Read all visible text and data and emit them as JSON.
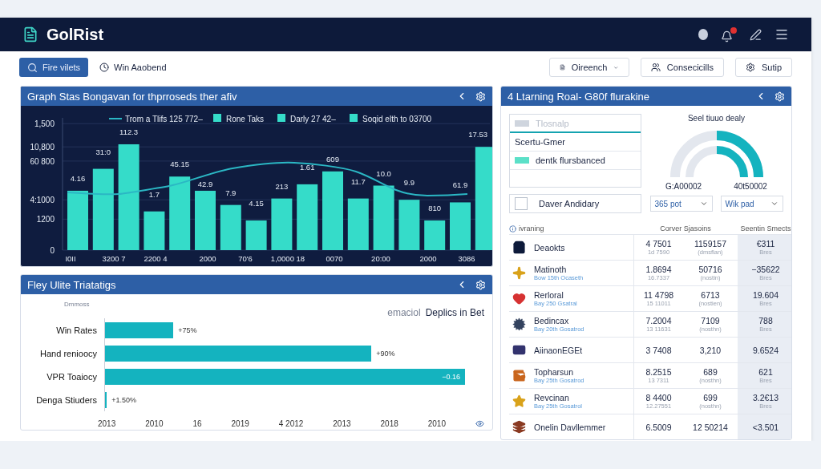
{
  "app": {
    "title": "GolRist"
  },
  "toolbar": {
    "primary_button": "Fire vilets",
    "time_label": "Win Aaobend",
    "dropdown": "Oireench",
    "buttons": [
      "Consecicills",
      "Sutip"
    ]
  },
  "top_chart": {
    "title": "Graph Stas Bongavan for thprroseds ther afiv",
    "legend": [
      {
        "kind": "line",
        "label": "Trom a Tlifs 125 772–"
      },
      {
        "kind": "swatch",
        "label": "Rone Taks"
      },
      {
        "kind": "swatch",
        "label": "Darly 27 42–"
      },
      {
        "kind": "swatch",
        "label": "Soqid elth to 03700"
      }
    ],
    "y_labels": [
      "1,500",
      "10,800",
      "60 800",
      "4:1000",
      "1200",
      "0"
    ],
    "x_labels": [
      "I0II",
      "3200 7",
      "2200 4",
      "2000",
      "70'6",
      "1,0000 18",
      "0070",
      "20:00",
      "2000",
      "3086"
    ],
    "bar_labels": [
      "4.16",
      "31:0",
      "112.3",
      "1.7",
      "45.15",
      "42.9",
      "7.9",
      "4.15",
      "213",
      "1.61",
      "609",
      "11.7",
      "10.0",
      "9.9",
      "810",
      "61.9",
      "17.53"
    ]
  },
  "bottom_chart": {
    "title": "Fley Ulite Triatatigs",
    "legend": "Dmmoss",
    "note": "emaciol",
    "heading": "Deplics in Bet",
    "rows": [
      {
        "label": "Win Rates",
        "level": 0.19,
        "reading": "+75%"
      },
      {
        "label": "Hand renioocy",
        "level": 0.74,
        "reading": "+90%"
      },
      {
        "label": "VPR Toaiocy",
        "level": 1.0,
        "reading": "−0.16"
      },
      {
        "label": "Denga Stiuders",
        "level": 0.005,
        "reading": "+1.50%"
      }
    ],
    "x_labels": [
      "2013",
      "2010",
      "16",
      "2019",
      "4 2012",
      "2013",
      "2018",
      "2010"
    ]
  },
  "right_panel": {
    "title": "4 Ltarning Roal- G80f flurakine",
    "list": [
      {
        "label": "Tlosnalp",
        "selected": true,
        "disabled": true
      },
      {
        "label": "Scertu-Gmer",
        "selected": false,
        "disabled": false
      },
      {
        "label": "dentk flursbanced",
        "selected": false,
        "disabled": false
      }
    ],
    "checkbox": {
      "label": "Daver Andidary",
      "checked": false
    },
    "gauge": {
      "title": "Seel tiuuo dealy"
    },
    "values": [
      "G:A00002",
      "40t50002"
    ],
    "dropdowns": [
      "365 pot",
      "Wik pad"
    ],
    "table": {
      "columns": [
        "ivraning",
        "Corver Sjasoins",
        "Seentin Smects"
      ],
      "rows": [
        {
          "name": "Deaokts",
          "a": "4 7501",
          "a_sub": "1d 7590",
          "b": "1159157",
          "b_sub": "(dmsflan)",
          "c": "€311",
          "c_sub": "Bres"
        },
        {
          "name": "Matinoth",
          "sub": "Bow 15th Ocaseth",
          "a": "1.8694",
          "a_sub": "16.7337",
          "b": "50716",
          "b_sub": "(nostin)",
          "c": "−35622",
          "c_sub": "Bres"
        },
        {
          "name": "Rerloral",
          "sub": "Bay 250 Gsatral",
          "a": "11 4798",
          "a_sub": "15 11011",
          "b": "6713",
          "b_sub": "(nostien)",
          "c": "19.604",
          "c_sub": "Bres"
        },
        {
          "name": "Bedincax",
          "sub": "Bay 20th Gosatrod",
          "a": "7.2004",
          "a_sub": "13 11631",
          "b": "7109",
          "b_sub": "(nosthn)",
          "c": "788",
          "c_sub": "Bres"
        },
        {
          "name": "AiinaonEGEt",
          "a": "3 7408",
          "b": "3,210",
          "c": "9.6524"
        },
        {
          "name": "Topharsun",
          "sub": "Bay 25th Gosatrod",
          "a": "8.2515",
          "a_sub": "13 7311",
          "b": "689",
          "b_sub": "(nosthn)",
          "c": "621",
          "c_sub": "Bres"
        },
        {
          "name": "Revcinan",
          "sub": "Bay 25th Gosatrol",
          "a": "8 4400",
          "a_sub": "12.27551",
          "b": "699",
          "b_sub": "(nosthn)",
          "c": "3.2€13",
          "c_sub": "Bres"
        },
        {
          "name": "Onelin Davllemmer",
          "a": "6.5009",
          "b": "12 50214",
          "c": "<3.501"
        }
      ]
    }
  }
}
